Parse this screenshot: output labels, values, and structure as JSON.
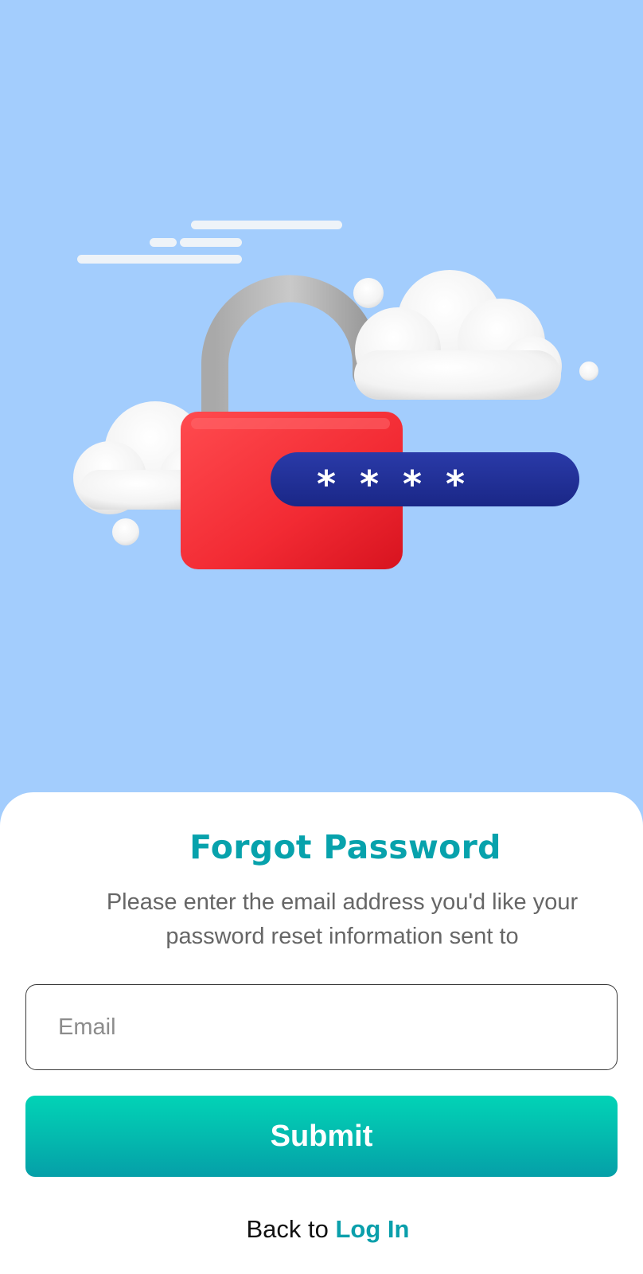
{
  "header": {
    "illustration": "padlock-password-icon"
  },
  "form": {
    "title": "Forgot Password",
    "description": "Please enter the email address you'd like your password reset information sent to",
    "email_placeholder": "Email",
    "email_value": "",
    "submit_label": "Submit"
  },
  "footer": {
    "back_prefix": "Back to",
    "login_label": "Log In"
  },
  "colors": {
    "background": "#a3cdfd",
    "accent": "#07a2ac",
    "button_top": "#01d3b6",
    "button_bottom": "#059fa8",
    "lock_body": "#f2333b",
    "password_bar": "#1f2f98"
  }
}
